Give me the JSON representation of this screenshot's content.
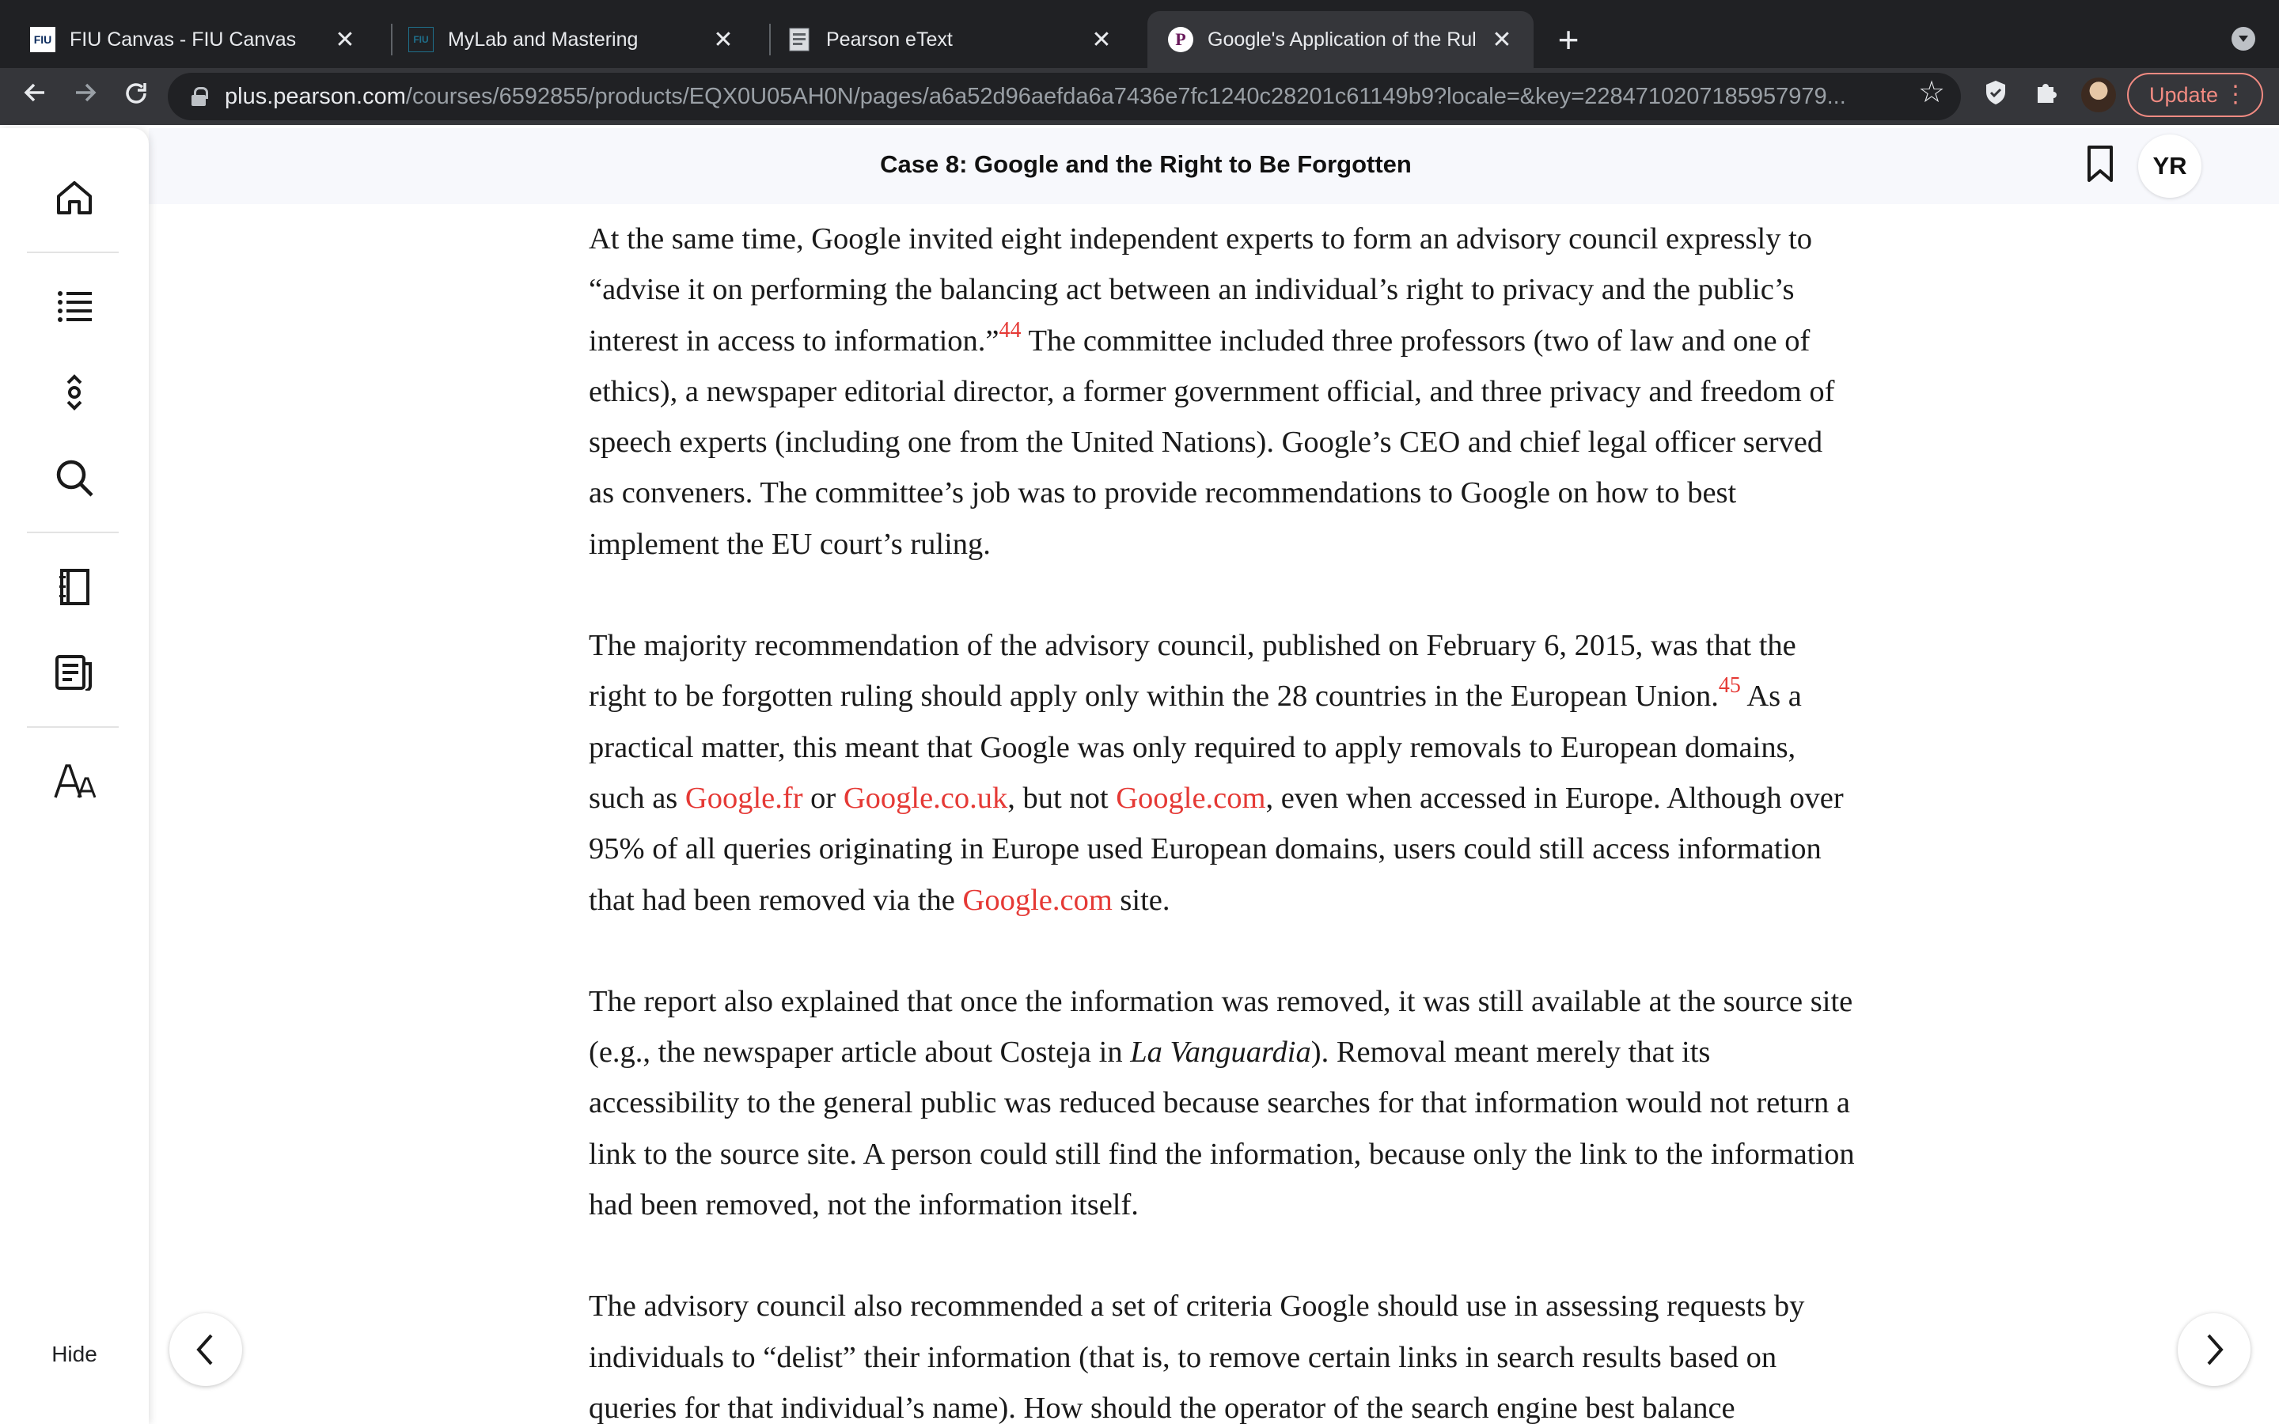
{
  "browser": {
    "tabs": [
      {
        "title": "FIU Canvas - FIU Canvas",
        "favicon": "FIU"
      },
      {
        "title": "MyLab and Mastering",
        "favicon": "FIU"
      },
      {
        "title": "Pearson eText",
        "favicon": "document-icon"
      },
      {
        "title": "Google's Application of the Rul",
        "favicon": "P"
      }
    ],
    "url_host": "plus.pearson.com",
    "url_path": "/courses/6592855/products/EQX0U05AH0N/pages/a6a52d96aefda6a7436e7fc1240c28201c61149b9?locale=&key=2284710207185957979...",
    "update_label": "Update"
  },
  "reader": {
    "title": "Case 8: Google and the Right to Be Forgotten",
    "user_initials": "YR",
    "hide_label": "Hide"
  },
  "colors": {
    "accent": "#e53935",
    "header_bg": "#f7f8fc"
  },
  "content": {
    "p1": {
      "a": "At the same time, Google invited eight independent experts to form an advisory council expressly to “advise it on performing the balancing act between an individual’s right to privacy and the public’s interest in access to information.”",
      "fn": "44",
      "b": " The committee included three professors (two of law and one of ethics), a newspaper editorial director, a former government official, and three privacy and freedom of speech experts (including one from the United Nations). Google’s CEO and chief legal officer served as conveners. The committee’s job was to provide recommendations to Google on how to best implement the EU court’s ruling."
    },
    "p2": {
      "a": "The majority recommendation of the advisory council, published on February 6, 2015, was that the right to be forgotten ruling should apply only within the 28 countries in the European Union.",
      "fn": "45",
      "b": " As a practical matter, this meant that Google was only required to apply removals to European domains, such as ",
      "link1": "Google.fr",
      "c": " or ",
      "link2": "Google.co.uk",
      "d": ", but not ",
      "link3": "Google.com",
      "e": ", even when accessed in Europe. Although over 95% of all queries originating in Europe used European domains, users could still access information that had been removed via the ",
      "link4": "Google.com",
      "f": " site."
    },
    "p3": {
      "a": "The report also explained that once the information was removed, it was still available at the source site (e.g., the newspaper article about Costeja in ",
      "italic": "La Vanguardia",
      "b": "). Removal meant merely that its accessibility to the general public was reduced because searches for that information would not return a link to the source site. A person could still find the information, because only the link to the information had been removed, not the information itself."
    },
    "p4": {
      "a": "The advisory council also recommended a set of criteria Google should use in assessing requests by individuals to “delist” their information (that is, to remove certain links in search results based on queries for that individual’s name). How should the operator of the search engine best balance"
    }
  }
}
